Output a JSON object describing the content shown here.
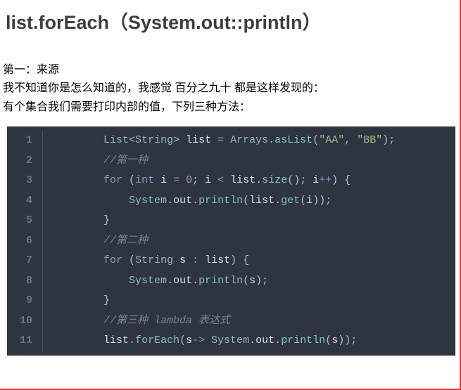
{
  "title": "list.forEach（System.out::println）",
  "paragraphs": [
    "第一：来源",
    "我不知道你是怎么知道的，我感觉 百分之九十 都是这样发现的：",
    "有个集合我们需要打印内部的值，下列三种方法："
  ],
  "code": {
    "indent": "        ",
    "lines": [
      [
        {
          "t": "type",
          "v": "List"
        },
        {
          "t": "punct",
          "v": "<"
        },
        {
          "t": "type",
          "v": "String"
        },
        {
          "t": "punct",
          "v": "> "
        },
        {
          "t": "plain",
          "v": "list "
        },
        {
          "t": "oper",
          "v": "= "
        },
        {
          "t": "type",
          "v": "Arrays"
        },
        {
          "t": "punct",
          "v": "."
        },
        {
          "t": "func",
          "v": "asList"
        },
        {
          "t": "punct",
          "v": "("
        },
        {
          "t": "string",
          "v": "\"AA\""
        },
        {
          "t": "punct",
          "v": ", "
        },
        {
          "t": "string",
          "v": "\"BB\""
        },
        {
          "t": "punct",
          "v": ");"
        }
      ],
      [
        {
          "t": "comment",
          "v": "//第一种"
        }
      ],
      [
        {
          "t": "keyword",
          "v": "for"
        },
        {
          "t": "punct",
          "v": " ("
        },
        {
          "t": "keyword",
          "v": "int"
        },
        {
          "t": "plain",
          "v": " i "
        },
        {
          "t": "oper",
          "v": "= "
        },
        {
          "t": "number",
          "v": "0"
        },
        {
          "t": "punct",
          "v": "; "
        },
        {
          "t": "plain",
          "v": "i "
        },
        {
          "t": "oper",
          "v": "< "
        },
        {
          "t": "plain",
          "v": "list"
        },
        {
          "t": "punct",
          "v": "."
        },
        {
          "t": "func",
          "v": "size"
        },
        {
          "t": "punct",
          "v": "(); "
        },
        {
          "t": "plain",
          "v": "i"
        },
        {
          "t": "oper",
          "v": "++"
        },
        {
          "t": "punct",
          "v": ") {"
        }
      ],
      [
        {
          "t": "plain",
          "v": "    "
        },
        {
          "t": "type",
          "v": "System"
        },
        {
          "t": "punct",
          "v": "."
        },
        {
          "t": "plain",
          "v": "out"
        },
        {
          "t": "punct",
          "v": "."
        },
        {
          "t": "func",
          "v": "println"
        },
        {
          "t": "punct",
          "v": "("
        },
        {
          "t": "plain",
          "v": "list"
        },
        {
          "t": "punct",
          "v": "."
        },
        {
          "t": "func",
          "v": "get"
        },
        {
          "t": "punct",
          "v": "("
        },
        {
          "t": "plain",
          "v": "i"
        },
        {
          "t": "punct",
          "v": "));"
        }
      ],
      [
        {
          "t": "punct",
          "v": "}"
        }
      ],
      [
        {
          "t": "comment",
          "v": "//第二种"
        }
      ],
      [
        {
          "t": "keyword",
          "v": "for"
        },
        {
          "t": "punct",
          "v": " ("
        },
        {
          "t": "type",
          "v": "String"
        },
        {
          "t": "plain",
          "v": " s "
        },
        {
          "t": "oper",
          "v": ": "
        },
        {
          "t": "plain",
          "v": "list"
        },
        {
          "t": "punct",
          "v": ") {"
        }
      ],
      [
        {
          "t": "plain",
          "v": "    "
        },
        {
          "t": "type",
          "v": "System"
        },
        {
          "t": "punct",
          "v": "."
        },
        {
          "t": "plain",
          "v": "out"
        },
        {
          "t": "punct",
          "v": "."
        },
        {
          "t": "func",
          "v": "println"
        },
        {
          "t": "punct",
          "v": "("
        },
        {
          "t": "plain",
          "v": "s"
        },
        {
          "t": "punct",
          "v": ");"
        }
      ],
      [
        {
          "t": "punct",
          "v": "}"
        }
      ],
      [
        {
          "t": "comment",
          "v": "//第三种 lambda 表达式"
        }
      ],
      [
        {
          "t": "plain",
          "v": "list"
        },
        {
          "t": "punct",
          "v": "."
        },
        {
          "t": "func",
          "v": "forEach"
        },
        {
          "t": "punct",
          "v": "("
        },
        {
          "t": "plain",
          "v": "s"
        },
        {
          "t": "oper",
          "v": "-> "
        },
        {
          "t": "type",
          "v": "System"
        },
        {
          "t": "punct",
          "v": "."
        },
        {
          "t": "plain",
          "v": "out"
        },
        {
          "t": "punct",
          "v": "."
        },
        {
          "t": "func",
          "v": "println"
        },
        {
          "t": "punct",
          "v": "("
        },
        {
          "t": "plain",
          "v": "s"
        },
        {
          "t": "punct",
          "v": "));"
        }
      ]
    ]
  }
}
